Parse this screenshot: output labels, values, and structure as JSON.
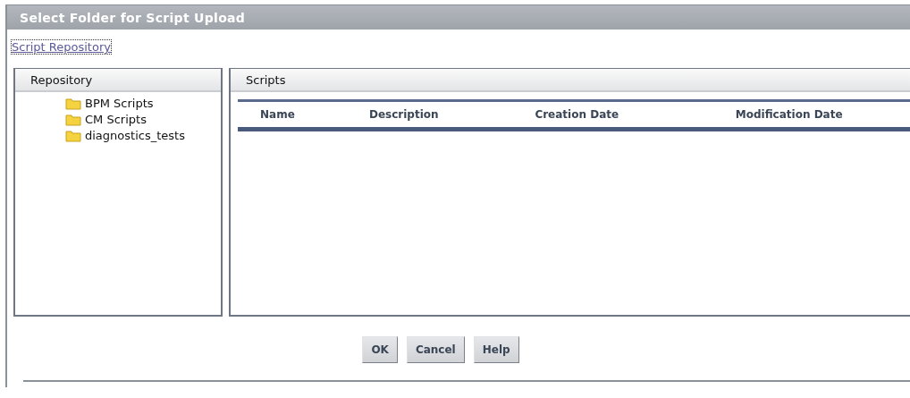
{
  "window": {
    "title": "Select Folder for Script Upload"
  },
  "breadcrumb": {
    "link": "Script Repository"
  },
  "repository": {
    "title": "Repository",
    "folders": [
      {
        "label": "BPM Scripts"
      },
      {
        "label": "CM Scripts"
      },
      {
        "label": "diagnostics_tests"
      }
    ]
  },
  "scripts": {
    "title": "Scripts",
    "columns": [
      "Name",
      "Description",
      "Creation Date",
      "Modification Date"
    ]
  },
  "buttons": [
    "OK",
    "Cancel",
    "Help"
  ]
}
